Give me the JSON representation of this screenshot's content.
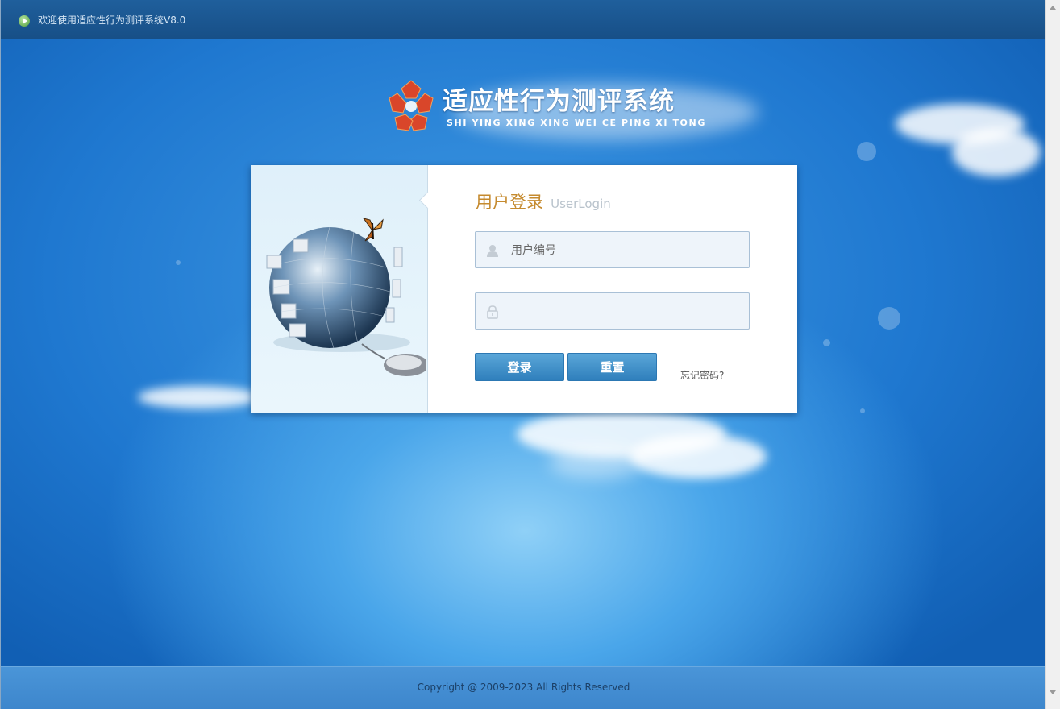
{
  "window": {
    "title": "欢迎使用适应性行为测评系统V8.0"
  },
  "brand": {
    "title": "适应性行为测评系统",
    "subtitle": "SHI YING XING XING WEI CE PING XI TONG",
    "logo_icon": "red-pentagon-logo-icon",
    "accent_color": "#c58a2e",
    "logo_color": "#d9462a"
  },
  "login": {
    "title_cn": "用户登录",
    "title_en": "UserLogin",
    "username": {
      "placeholder": "用户编号",
      "value": "",
      "icon": "user-icon"
    },
    "password": {
      "placeholder": "",
      "value": "",
      "icon": "lock-icon"
    },
    "login_label": "登录",
    "reset_label": "重置",
    "forgot_label": "忘记密码?"
  },
  "footer": {
    "copyright": "Copyright @ 2009-2023 All Rights Reserved"
  }
}
